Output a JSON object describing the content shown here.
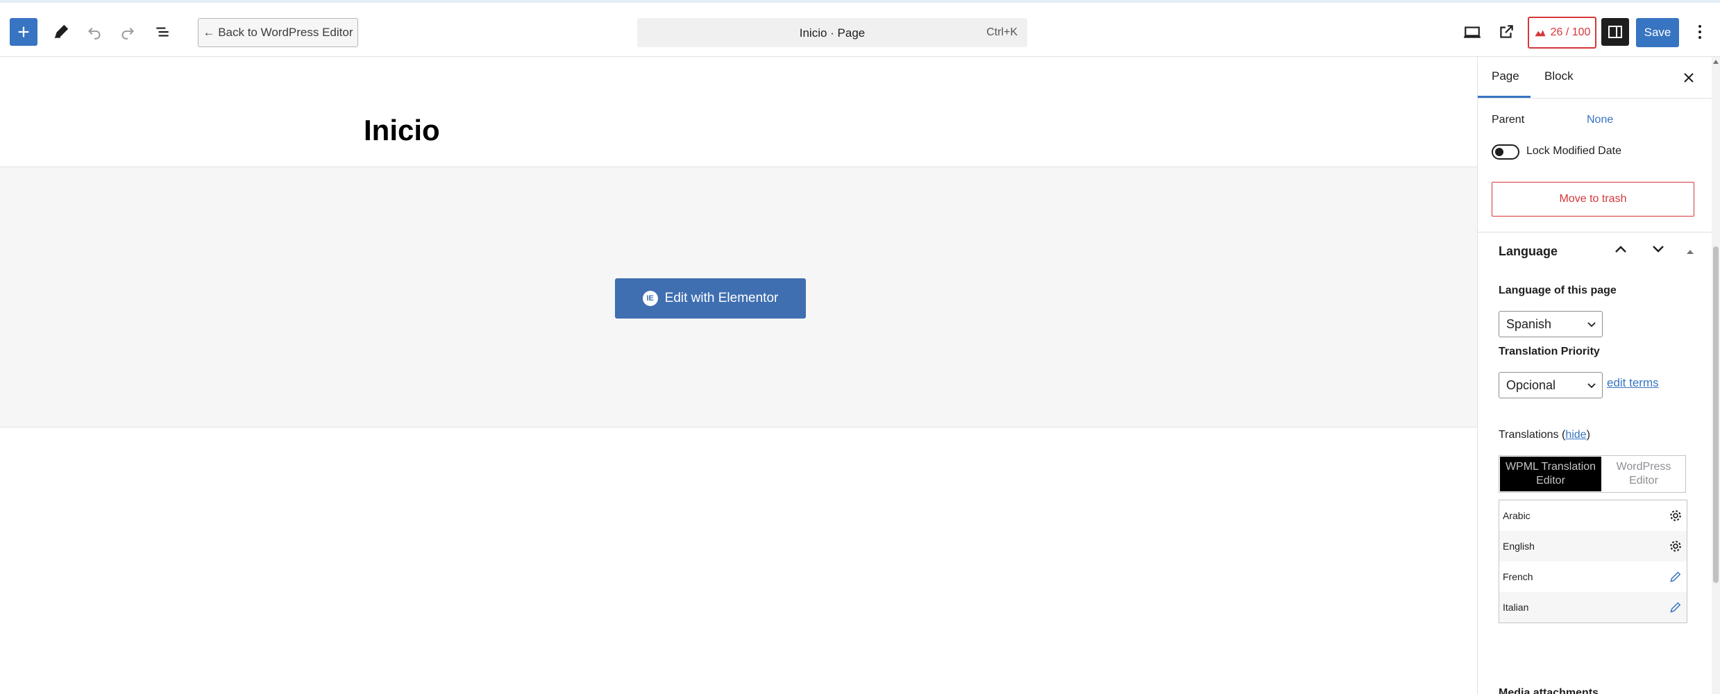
{
  "toolbar": {
    "back_label": "← Back to WordPress Editor",
    "command_title": "Inicio · Page",
    "command_shortcut": "Ctrl+K",
    "seo_score": "26 / 100",
    "save_label": "Save",
    "icons": [
      "plus-icon",
      "pencil-icon",
      "undo-icon",
      "redo-icon",
      "list-view-icon",
      "desktop-preview-icon",
      "external-link-icon",
      "seo-icon",
      "sidebar-icon",
      "more-vertical-icon"
    ]
  },
  "canvas": {
    "page_title": "Inicio",
    "elementor_button_label": "Edit with Elementor",
    "elementor_logo": "IE"
  },
  "sidebar": {
    "tabs": {
      "page": "Page",
      "block": "Block"
    },
    "parent_label": "Parent",
    "parent_value": "None",
    "lock_label": "Lock Modified Date",
    "lock_enabled": false,
    "trash_label": "Move to trash",
    "language": {
      "heading": "Language",
      "page_language_label": "Language of this page",
      "page_language_value": "Spanish",
      "priority_label": "Translation Priority",
      "priority_value": "Opcional",
      "edit_terms": "edit terms",
      "translations_prefix": "Translations (",
      "translations_hide": "hide",
      "translations_suffix": ")",
      "editor_wpml": "WPML Translation Editor",
      "editor_wp": "WordPress Editor",
      "rows": [
        {
          "name": "Arabic",
          "icon": "gear-icon"
        },
        {
          "name": "English",
          "icon": "gear-icon"
        },
        {
          "name": "French",
          "icon": "pencil-icon"
        },
        {
          "name": "Italian",
          "icon": "pencil-icon"
        }
      ],
      "next_section_partial": "Media attachments"
    }
  },
  "colors": {
    "accent": "#3774c2",
    "danger": "#d63638",
    "elementor": "#3f6fb0"
  }
}
